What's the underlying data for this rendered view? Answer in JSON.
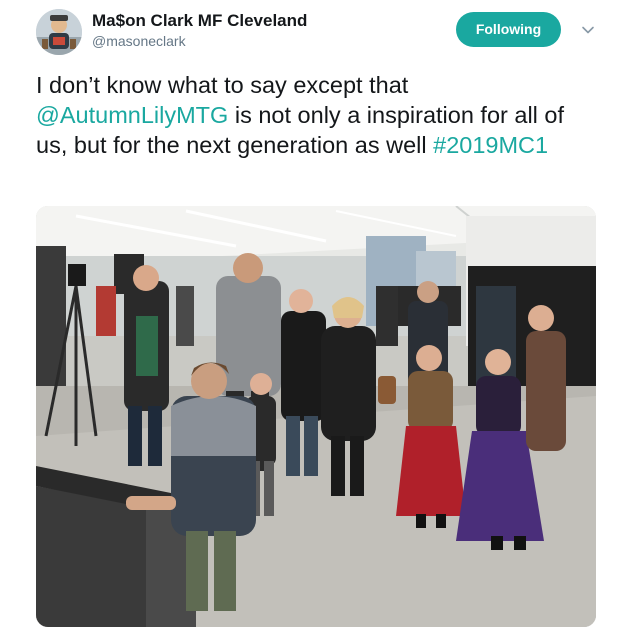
{
  "user": {
    "display_name": "Ma$on Clark MF Cleveland",
    "handle": "@masoneclark",
    "avatar_icon": "avatar-image"
  },
  "follow_button": {
    "label": "Following",
    "color": "#1aa8a0"
  },
  "menu_icon": "chevron-down-icon",
  "tweet": {
    "text_part1": "I don’t know what to say except that ",
    "mention": "@AutumnLilyMTG",
    "text_part2": " is not only a inspiration for all of us, but for the next generation as well ",
    "hashtag": "#2019MC1",
    "link_color": "#1aa8a0"
  },
  "media": {
    "type": "photo",
    "icon": "photo-image"
  }
}
